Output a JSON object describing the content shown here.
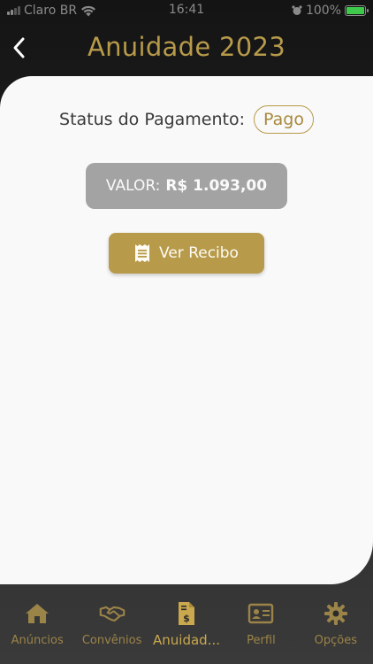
{
  "status_bar": {
    "carrier": "Claro BR",
    "time": "16:41",
    "battery": "100%"
  },
  "header": {
    "title": "Anuidade 2023"
  },
  "payment": {
    "status_label": "Status do Pagamento:",
    "status_value": "Pago",
    "valor_label": "VALOR:",
    "valor_amount": "R$ 1.093,00",
    "recibo_label": "Ver Recibo"
  },
  "nav": {
    "items": [
      {
        "label": "Anúncios",
        "icon": "home-icon"
      },
      {
        "label": "Convênios",
        "icon": "handshake-icon"
      },
      {
        "label": "Anuidad...",
        "icon": "invoice-icon"
      },
      {
        "label": "Perfil",
        "icon": "id-card-icon"
      },
      {
        "label": "Opções",
        "icon": "gear-icon"
      }
    ],
    "active_index": 2
  },
  "colors": {
    "accent": "#b79a4a",
    "valor_bg": "#a3a3a3",
    "battery": "#3ec94d"
  }
}
